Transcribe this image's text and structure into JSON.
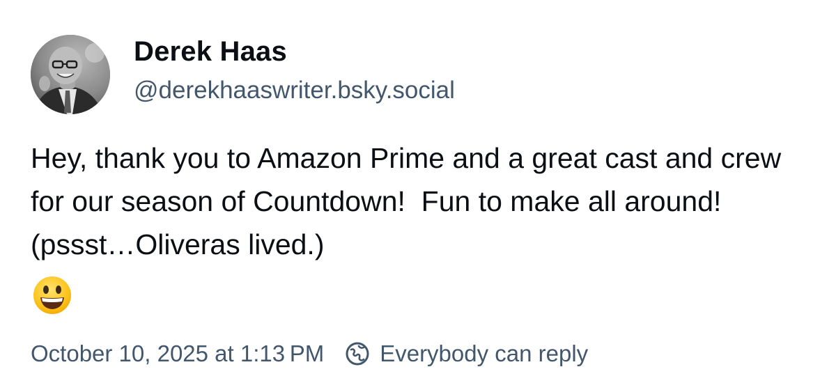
{
  "author": {
    "display_name": "Derek Haas",
    "handle": "@derekhaaswriter.bsky.social",
    "avatar_icon": "profile-photo"
  },
  "post": {
    "text": "Hey, thank you to Amazon Prime and a great cast and crew for our season of Countdown!  Fun to make all around!  (pssst…Oliveras lived.)",
    "emoji": "grinning-face-emoji"
  },
  "meta": {
    "timestamp": "October 10, 2025 at 1:13 PM",
    "reply_setting": "Everybody can reply",
    "reply_icon": "earth-globe-icon"
  },
  "colors": {
    "text_primary": "#0b0f14",
    "text_secondary": "#42576c",
    "background": "#ffffff"
  }
}
